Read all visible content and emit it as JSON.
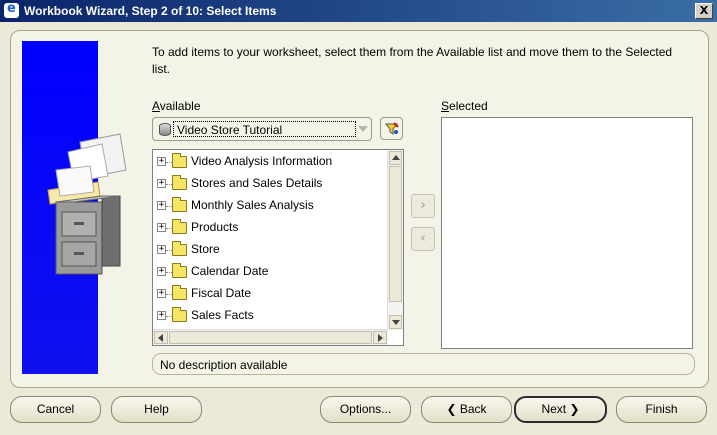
{
  "window": {
    "title": "Workbook Wizard, Step 2 of 10: Select Items",
    "close_glyph": "X"
  },
  "instructions": "To add items to your worksheet, select them from the Available list and move them to the Selected list.",
  "available": {
    "label_accel": "A",
    "label_rest": "vailable",
    "business_area": "Video Store Tutorial",
    "items": [
      "Video Analysis Information",
      "Stores and Sales Details",
      "Monthly Sales Analysis",
      "Products",
      "Store",
      "Calendar Date",
      "Fiscal Date",
      "Sales Facts"
    ]
  },
  "selected": {
    "label_accel": "S",
    "label_rest": "elected"
  },
  "move_buttons": {
    "add": "›",
    "remove": "‹"
  },
  "description": "No description available",
  "buttons": {
    "cancel": "Cancel",
    "help": "Help",
    "options": "Options...",
    "back": "Back",
    "next": "Next",
    "finish": "Finish"
  }
}
